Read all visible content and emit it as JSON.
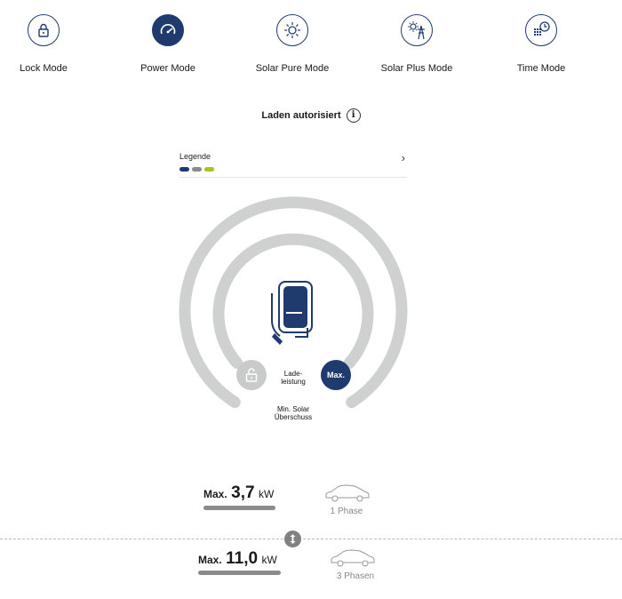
{
  "modes": [
    {
      "label": "Lock Mode",
      "icon": "lock-icon",
      "active": false
    },
    {
      "label": "Power Mode",
      "icon": "speedometer-icon",
      "active": true
    },
    {
      "label": "Solar Pure Mode",
      "icon": "sun-icon",
      "active": false
    },
    {
      "label": "Solar Plus Mode",
      "icon": "sun-grid-icon",
      "active": false
    },
    {
      "label": "Time Mode",
      "icon": "calendar-clock-icon",
      "active": false
    }
  ],
  "status": {
    "label": "Laden autorisiert",
    "info_icon": "info-icon"
  },
  "legend": {
    "label": "Legende",
    "colors": [
      "#1f3b6e",
      "#8a8c8c",
      "#a7c520"
    ]
  },
  "gauge": {
    "ring_color": "#cfd1d1",
    "accent": "#1f3b6e",
    "center_label_line1": "Lade-",
    "center_label_line2": "leistung",
    "bottom_label_line1": "Min. Solar",
    "bottom_label_line2": "Überschuss",
    "max_button_label": "Max."
  },
  "charging_options": [
    {
      "prefix": "Max.",
      "value": "3,7",
      "unit": "kW",
      "phase": "1 Phase"
    },
    {
      "prefix": "Max.",
      "value": "11,0",
      "unit": "kW",
      "phase": "3 Phasen"
    }
  ]
}
